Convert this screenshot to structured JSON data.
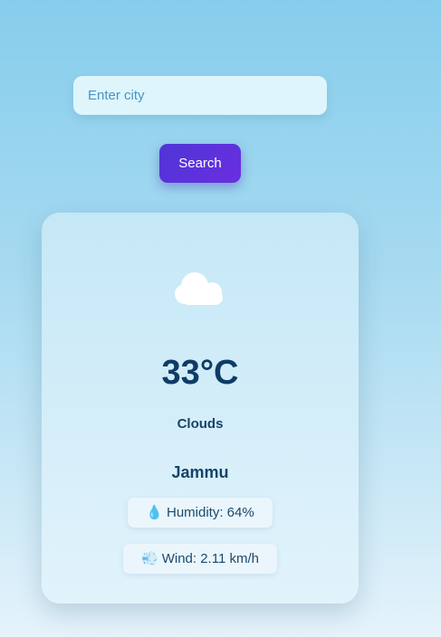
{
  "search": {
    "placeholder": "Enter city",
    "value": "",
    "button_label": "Search"
  },
  "weather": {
    "icon": "cloud-icon",
    "temperature": "33°C",
    "description": "Clouds",
    "city": "Jammu",
    "humidity": {
      "icon": "💧",
      "text": "Humidity: 64%"
    },
    "wind": {
      "icon": "💨",
      "text": "Wind: 2.11 km/h"
    }
  },
  "colors": {
    "button": "#5a31dc",
    "temperature_text": "#0e3c66",
    "cloud": "#ffffff"
  }
}
